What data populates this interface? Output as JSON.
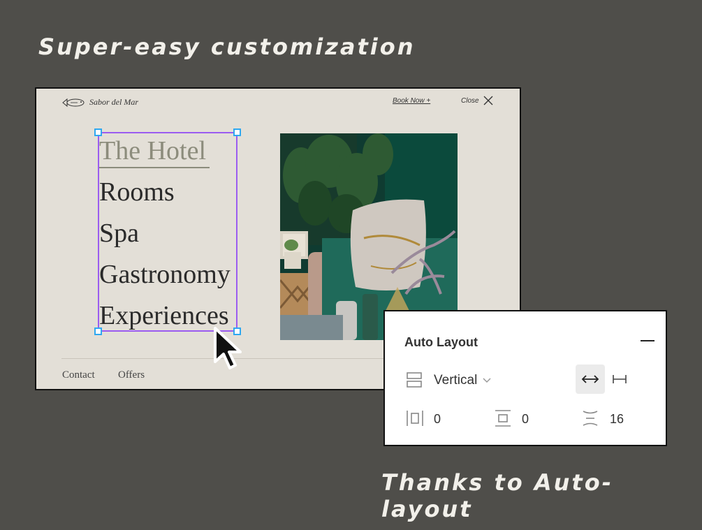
{
  "headlines": {
    "top": "Super-easy customization",
    "bottom": "Thanks to Auto-layout"
  },
  "site": {
    "brand": "Sabor del Mar",
    "book_now": "Book Now +",
    "close": "Close",
    "menu": [
      "The Hotel",
      "Rooms",
      "Spa",
      "Gastronomy",
      "Experiences"
    ],
    "footer_links": [
      "Contact",
      "Offers"
    ],
    "colors": {
      "background": "#e3dfd7",
      "active_menu": "#8c8c7c",
      "selection": "#9b5cf0",
      "handle": "#2fa8f0"
    }
  },
  "panel": {
    "title": "Auto Layout",
    "direction": "Vertical",
    "padding_horizontal": "0",
    "padding_vertical": "0",
    "spacing": "16",
    "icons": [
      "vertical-stack-icon",
      "chevron-down-icon",
      "hug-horizontal-icon",
      "fixed-width-icon",
      "horizontal-padding-icon",
      "vertical-padding-icon",
      "spacing-between-icon",
      "minus-icon"
    ]
  },
  "cursor": "arrow-pointer-icon"
}
